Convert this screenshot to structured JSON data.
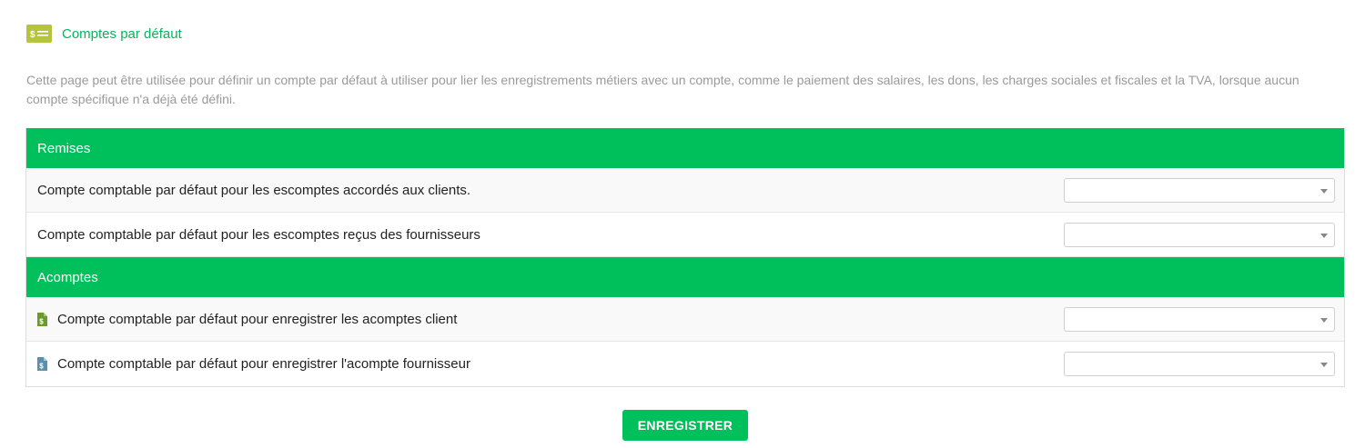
{
  "header": {
    "icon": "money-bill-icon",
    "title": "Comptes par défaut"
  },
  "description": "Cette page peut être utilisée pour définir un compte par défaut à utiliser pour lier les enregistrements métiers avec un compte, comme le paiement des salaires, les dons, les charges sociales et fiscales et la TVA, lorsque aucun compte spécifique n'a déjà été défini.",
  "sections": [
    {
      "title": "Remises",
      "rows": [
        {
          "label": "Compte comptable par défaut pour les escomptes accordés aux clients.",
          "value": ""
        },
        {
          "label": "Compte comptable par défaut pour les escomptes reçus des fournisseurs",
          "value": ""
        }
      ]
    },
    {
      "title": "Acomptes",
      "rows": [
        {
          "label": "Compte comptable par défaut pour enregistrer les acomptes client",
          "value": "",
          "icon": "customer-invoice-icon"
        },
        {
          "label": "Compte comptable par défaut pour enregistrer l'acompte fournisseur",
          "value": "",
          "icon": "supplier-invoice-icon"
        }
      ]
    }
  ],
  "save_button": "ENREGISTRER",
  "colors": {
    "accent": "#00c05c",
    "title": "#00b85c",
    "header_icon": "#b5c43a",
    "customer_icon": "#6a9a2c",
    "supplier_icon": "#5a8fb0",
    "description": "#9a9a9a"
  }
}
